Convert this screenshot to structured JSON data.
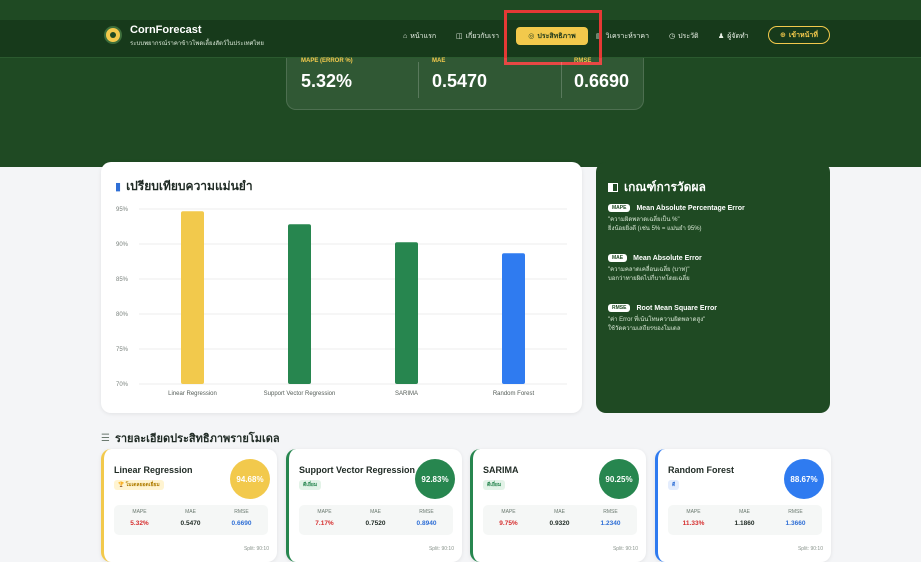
{
  "header": {
    "brand_title": "CornForecast",
    "brand_sub": "ระบบพยากรณ์ราคาข้าวโพดเลี้ยงสัตว์ในประเทศไทย",
    "nav": [
      {
        "icon": "⌂",
        "label": "หน้าแรก"
      },
      {
        "icon": "◫",
        "label": "เกี่ยวกับเรา"
      },
      {
        "icon": "◎",
        "label": "ประสิทธิภาพ"
      },
      {
        "icon": "▤",
        "label": "วิเคราะห์ราคา"
      },
      {
        "icon": "◷",
        "label": "ประวัติ"
      },
      {
        "icon": "♟",
        "label": "ผู้จัดทำ"
      }
    ],
    "login_icon": "⊕",
    "login_label": "เข้าหน้าที่"
  },
  "kpis": [
    {
      "label": "MAPE (ERROR %)",
      "value": "5.32%"
    },
    {
      "label": "MAE",
      "value": "0.5470"
    },
    {
      "label": "RMSE",
      "value": "0.6690"
    }
  ],
  "chart_data": {
    "type": "bar",
    "title": "เปรียบเทียบความแม่นยำ",
    "categories": [
      "Linear Regression",
      "Support Vector Regression",
      "SARIMA",
      "Random Forest"
    ],
    "values": [
      94.68,
      92.83,
      90.25,
      88.67
    ],
    "colors": [
      "#f2c94c",
      "#27864f",
      "#27864f",
      "#2f7bf0"
    ],
    "ylim": [
      70,
      95
    ],
    "yticks": [
      "70%",
      "75%",
      "80%",
      "85%",
      "90%",
      "95%"
    ],
    "grid": true,
    "legend": "none"
  },
  "criteria": {
    "title": "เกณฑ์การวัดผล",
    "items": [
      {
        "tag": "MAPE",
        "name": "Mean Absolute Percentage Error",
        "desc1": "\"ความผิดพลาดเฉลี่ยเป็น %\"",
        "desc2": "ยิ่งน้อยยิ่งดี (เช่น 5% = แม่นยำ 95%)"
      },
      {
        "tag": "MAE",
        "name": "Mean Absolute Error",
        "desc1": "\"ความคลาดเคลื่อนเฉลี่ย (บาท)\"",
        "desc2": "บอกว่าทายผิดไปกี่บาทโดยเฉลี่ย"
      },
      {
        "tag": "RMSE",
        "name": "Root Mean Square Error",
        "desc1": "\"ค่า Error ที่เน้นโทษความผิดพลาดสูง\"",
        "desc2": "ใช้วัดความเสถียรของโมเดล"
      }
    ]
  },
  "details": {
    "title": "รายละเอียดประสิทธิภาพรายโมเดล",
    "metric_labels": [
      "MAPE",
      "MAE",
      "RMSE"
    ],
    "models": [
      {
        "name": "Linear Regression",
        "badge": "🏆 โมเดลยอดเยี่ยม",
        "accuracy": "94.68%",
        "mape": "5.32%",
        "mae": "0.5470",
        "rmse": "0.6690",
        "split": "Split: 90:10",
        "color": "#f2c94c"
      },
      {
        "name": "Support Vector Regression",
        "badge": "ดีเยี่ยม",
        "accuracy": "92.83%",
        "mape": "7.17%",
        "mae": "0.7520",
        "rmse": "0.8940",
        "split": "Split: 90:10",
        "color": "#27864f"
      },
      {
        "name": "SARIMA",
        "badge": "ดีเยี่ยม",
        "accuracy": "90.25%",
        "mape": "9.75%",
        "mae": "0.9320",
        "rmse": "1.2340",
        "split": "Split: 90:10",
        "color": "#27864f"
      },
      {
        "name": "Random Forest",
        "badge": "ดี",
        "accuracy": "88.67%",
        "mape": "11.33%",
        "mae": "1.1860",
        "rmse": "1.3660",
        "split": "Split: 90:10",
        "color": "#2f7bf0"
      }
    ]
  },
  "colors": {
    "brand_green": "#1f4a23",
    "accent_yellow": "#f2c94c",
    "error_red": "#d62f2f",
    "value_blue": "#2f6fd6"
  }
}
